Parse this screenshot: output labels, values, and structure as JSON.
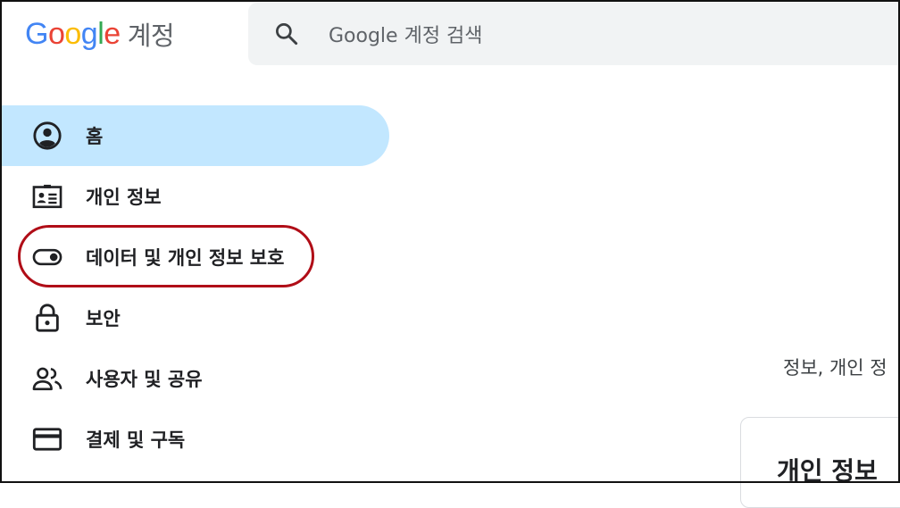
{
  "header": {
    "logo": {
      "letters": [
        "G",
        "o",
        "o",
        "g",
        "l",
        "e"
      ],
      "letter_colors": [
        "#4285F4",
        "#EA4335",
        "#FBBC05",
        "#4285F4",
        "#34A853",
        "#EA4335"
      ],
      "product": "계정"
    },
    "search": {
      "placeholder": "Google 계정 검색",
      "value": "",
      "icon": "search-icon"
    }
  },
  "sidebar": {
    "items": [
      {
        "label": "홈",
        "icon": "account-circle-icon",
        "active": true
      },
      {
        "label": "개인 정보",
        "icon": "id-card-icon",
        "active": false
      },
      {
        "label": "데이터 및 개인 정보 보호",
        "icon": "toggle-icon",
        "active": false,
        "highlighted": true
      },
      {
        "label": "보안",
        "icon": "lock-icon",
        "active": false
      },
      {
        "label": "사용자 및 공유",
        "icon": "people-icon",
        "active": false
      },
      {
        "label": "결제 및 구독",
        "icon": "credit-card-icon",
        "active": false
      }
    ]
  },
  "main": {
    "description": "정보, 개인 정",
    "card_title": "개인 정보"
  },
  "colors": {
    "active_bg": "#c2e7ff",
    "search_bg": "#f1f3f4",
    "highlight_ring": "#b00d17"
  }
}
